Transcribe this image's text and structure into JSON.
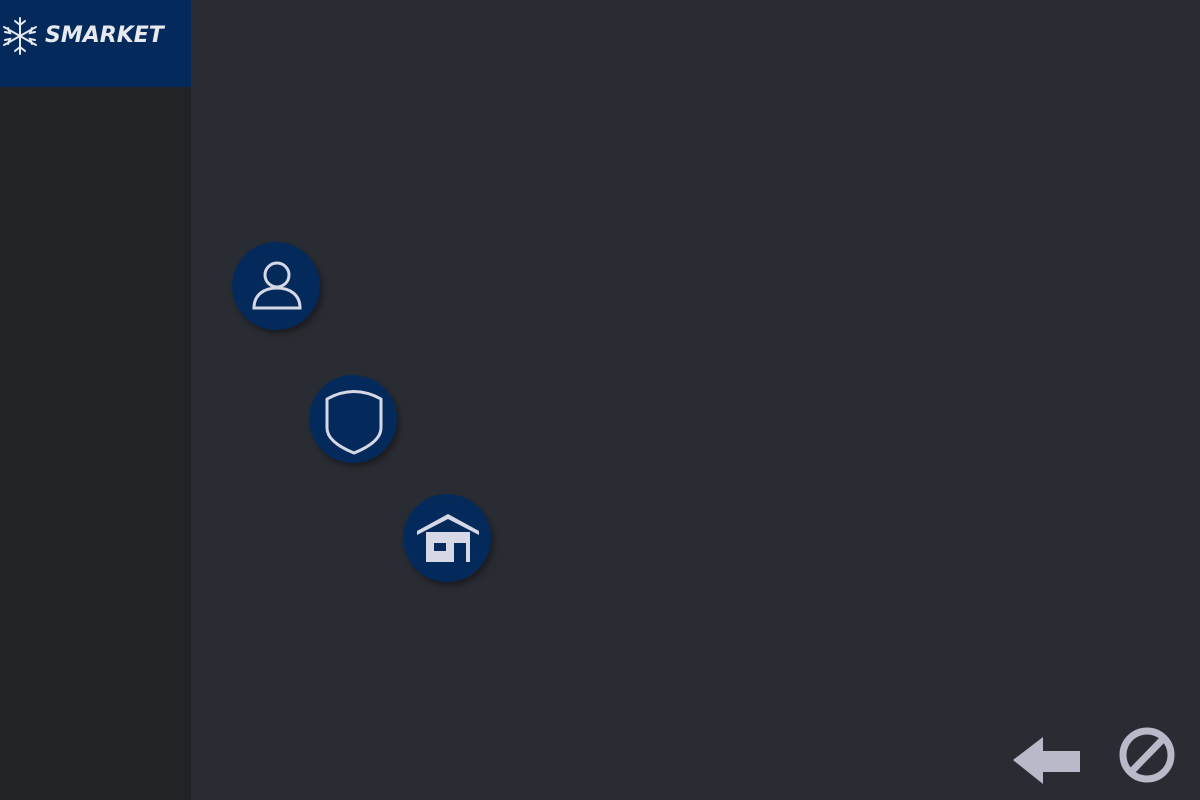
{
  "app": {
    "brand": "SMARKET"
  },
  "icons": {
    "logo": "snowflake-icon",
    "user": "user-icon",
    "shield": "shield-icon",
    "home": "home-icon",
    "back": "back-arrow-icon",
    "cancel": "cancel-icon"
  },
  "colors": {
    "background": "#2a2c33",
    "sidebar": "#222327",
    "brand_blue": "#042a5c",
    "icon_light": "#d6d8e6",
    "bottom_icon": "#b9b9c9"
  }
}
